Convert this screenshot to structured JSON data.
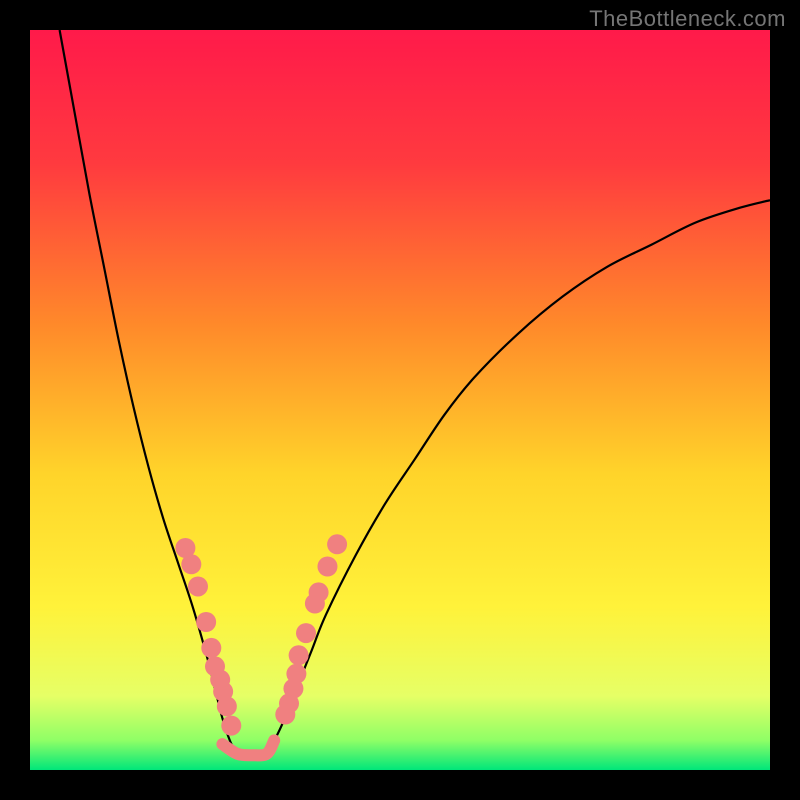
{
  "watermark": "TheBottleneck.com",
  "chart_data": {
    "type": "line",
    "title": "",
    "xlabel": "",
    "ylabel": "",
    "xlim": [
      0,
      100
    ],
    "ylim": [
      0,
      100
    ],
    "gradient_stops": [
      {
        "offset": 0.0,
        "color": "#ff1a4a"
      },
      {
        "offset": 0.18,
        "color": "#ff3a3f"
      },
      {
        "offset": 0.4,
        "color": "#ff8a2a"
      },
      {
        "offset": 0.6,
        "color": "#ffd42a"
      },
      {
        "offset": 0.78,
        "color": "#fff23a"
      },
      {
        "offset": 0.9,
        "color": "#e6ff66"
      },
      {
        "offset": 0.96,
        "color": "#8fff66"
      },
      {
        "offset": 1.0,
        "color": "#00e67a"
      }
    ],
    "series": [
      {
        "name": "left-curve",
        "stroke": "#000000",
        "x": [
          4,
          6,
          8,
          10,
          12,
          14,
          16,
          18,
          20,
          22,
          24,
          25,
          26,
          27,
          28
        ],
        "y": [
          100,
          89,
          78,
          68,
          58,
          49,
          41,
          34,
          28,
          22,
          15,
          11,
          7,
          4,
          2
        ]
      },
      {
        "name": "right-curve",
        "stroke": "#000000",
        "x": [
          32,
          34,
          36,
          38,
          40,
          44,
          48,
          52,
          56,
          60,
          66,
          72,
          78,
          84,
          90,
          96,
          100
        ],
        "y": [
          2,
          6,
          11,
          16,
          21,
          29,
          36,
          42,
          48,
          53,
          59,
          64,
          68,
          71,
          74,
          76,
          77
        ]
      },
      {
        "name": "valley-floor",
        "stroke": "#f08080",
        "stroke_width": 12,
        "linecap": "round",
        "x": [
          26,
          28,
          30,
          32,
          33
        ],
        "y": [
          3.5,
          2.2,
          2.0,
          2.2,
          4.0
        ]
      }
    ],
    "markers": {
      "left_wall": {
        "color": "#f08080",
        "radius": 10,
        "points": [
          {
            "x": 21.0,
            "y": 30.0
          },
          {
            "x": 21.8,
            "y": 27.8
          },
          {
            "x": 22.7,
            "y": 24.8
          },
          {
            "x": 23.8,
            "y": 20.0
          },
          {
            "x": 24.5,
            "y": 16.5
          },
          {
            "x": 25.0,
            "y": 14.0
          },
          {
            "x": 25.7,
            "y": 12.2
          },
          {
            "x": 26.1,
            "y": 10.6
          },
          {
            "x": 26.6,
            "y": 8.6
          },
          {
            "x": 27.2,
            "y": 6.0
          }
        ]
      },
      "right_wall": {
        "color": "#f08080",
        "radius": 10,
        "points": [
          {
            "x": 34.5,
            "y": 7.5
          },
          {
            "x": 35.0,
            "y": 9.0
          },
          {
            "x": 35.6,
            "y": 11.0
          },
          {
            "x": 36.0,
            "y": 13.0
          },
          {
            "x": 36.3,
            "y": 15.5
          },
          {
            "x": 37.3,
            "y": 18.5
          },
          {
            "x": 38.5,
            "y": 22.5
          },
          {
            "x": 39.0,
            "y": 24.0
          },
          {
            "x": 40.2,
            "y": 27.5
          },
          {
            "x": 41.5,
            "y": 30.5
          }
        ]
      }
    }
  }
}
